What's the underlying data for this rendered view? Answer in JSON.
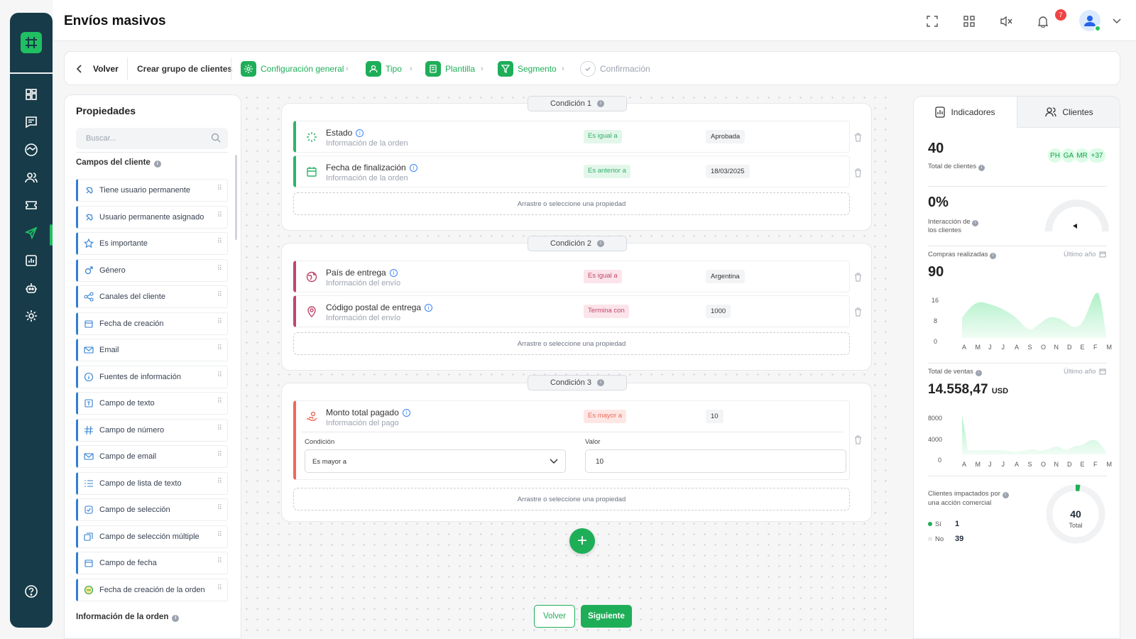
{
  "header": {
    "title": "Envíos masivos",
    "notifications": "7"
  },
  "stepper": {
    "back": "Volver",
    "group": "Crear grupo de clientes",
    "steps": [
      {
        "label": "Configuración general"
      },
      {
        "label": "Tipo"
      },
      {
        "label": "Plantilla"
      },
      {
        "label": "Segmento"
      },
      {
        "label": "Confirmación"
      }
    ]
  },
  "props": {
    "title": "Propiedades",
    "search_placeholder": "Buscar...",
    "section_client": "Campos del cliente",
    "section_order": "Información de la orden",
    "items": [
      "Tiene usuario permanente",
      "Usuario permanente asignado",
      "Es importante",
      "Género",
      "Canales del cliente",
      "Fecha de creación",
      "Email",
      "Fuentes de información",
      "Campo de texto",
      "Campo de número",
      "Campo de email",
      "Campo de lista de texto",
      "Campo de selección",
      "Campo de selección múltiple",
      "Campo de fecha",
      "Fecha de creación de la orden"
    ]
  },
  "conditions": [
    {
      "label": "Condición 1",
      "rows": [
        {
          "name": "Estado",
          "sub": "Información de la orden",
          "op": "Es igual a",
          "value": "Aprobada"
        },
        {
          "name": "Fecha de finalización",
          "sub": "Información de la orden",
          "op": "Es anterior a",
          "value": "18/03/2025"
        }
      ],
      "drop": "Arrastre o seleccione una propiedad"
    },
    {
      "label": "Condición 2",
      "rows": [
        {
          "name": "País de entrega",
          "sub": "Información del envío",
          "op": "Es igual a",
          "value": "Argentina"
        },
        {
          "name": "Código postal de entrega",
          "sub": "Información del envío",
          "op": "Termina con",
          "value": "1000"
        }
      ],
      "drop": "Arrastre o seleccione una propiedad"
    },
    {
      "label": "Condición 3",
      "rows": [
        {
          "name": "Monto total pagado",
          "sub": "Información del pago",
          "op": "Es mayor a",
          "value": "10"
        }
      ],
      "edit": {
        "cond_label": "Condición",
        "cond_value": "Es mayor a",
        "val_label": "Valor",
        "val_value": "10"
      },
      "drop": "Arrastre o seleccione una propiedad"
    }
  ],
  "footer": {
    "back": "Volver",
    "next": "Siguiente"
  },
  "indicators": {
    "tab1": "Indicadores",
    "tab2": "Clientes",
    "total_clients": "40",
    "total_clients_label": "Total de clientes",
    "avatars": [
      "PH",
      "GA",
      "MR",
      "+37"
    ],
    "interaction": "0%",
    "interaction_label_1": "Interacción de",
    "interaction_label_2": "los clientes",
    "purchases_label": "Compras realizadas",
    "purchases_period": "Último año",
    "purchases": "90",
    "sales_label": "Total de ventas",
    "sales_period": "Último año",
    "sales": "14.558,47",
    "sales_unit": "USD",
    "impact_label_1": "Clientes impactados por",
    "impact_label_2": "una acción comercial",
    "yes_label": "Sí",
    "yes_value": "1",
    "no_label": "No",
    "no_value": "39",
    "donut_total": "40",
    "donut_label": "Total",
    "months": [
      "A",
      "M",
      "J",
      "J",
      "A",
      "S",
      "O",
      "N",
      "D",
      "E",
      "F",
      "M"
    ],
    "purchases_ticks": [
      "16",
      "8",
      "0"
    ],
    "sales_ticks": [
      "8000",
      "4000",
      "0"
    ]
  },
  "colors": {
    "accent": "#1fae58",
    "rail": "#173b48",
    "blue": "#2f7fd0",
    "cond1": "#2fb36a",
    "cond2": "#c0476b",
    "cond3": "#ee6a5a"
  }
}
